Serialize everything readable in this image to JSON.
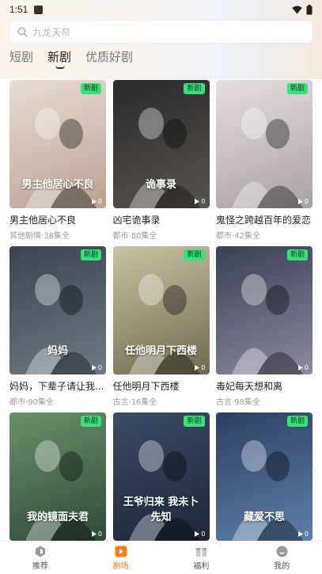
{
  "status_bar": {
    "time": "1:51"
  },
  "search": {
    "placeholder": "九龙天帝"
  },
  "tabs": [
    {
      "label": "短剧",
      "active": false
    },
    {
      "label": "新剧",
      "active": true
    },
    {
      "label": "优质好剧",
      "active": false
    }
  ],
  "badge_label": "新剧",
  "dramas": [
    {
      "title": "男主他居心不良",
      "category": "其他剧情",
      "episodes": "38集全",
      "plays": "0",
      "calligraphy": "男主他居心不良",
      "colors": [
        "#e8dcd4",
        "#b9a294"
      ]
    },
    {
      "title": "凶宅诡事录",
      "category": "都市",
      "episodes": "80集全",
      "plays": "0",
      "calligraphy": "诡事录",
      "colors": [
        "#2b2a2a",
        "#57534e"
      ]
    },
    {
      "title": "鬼怪之跨越百年的爱恋",
      "category": "都市",
      "episodes": "42集全",
      "plays": "0",
      "calligraphy": "",
      "colors": [
        "#e6dede",
        "#a8a0a6"
      ]
    },
    {
      "title": "妈妈，下辈子请让我...",
      "category": "都市",
      "episodes": "90集全",
      "plays": "0",
      "calligraphy": "妈妈",
      "colors": [
        "#3b4350",
        "#6f7a84"
      ]
    },
    {
      "title": "任他明月下西楼",
      "category": "古言",
      "episodes": "16集全",
      "plays": "0",
      "calligraphy": "任他明月下西楼",
      "colors": [
        "#c9c3a4",
        "#6f6a4e"
      ]
    },
    {
      "title": "毒妃每天想和离",
      "category": "古言",
      "episodes": "98集全",
      "plays": "0",
      "calligraphy": "",
      "colors": [
        "#3a3f52",
        "#8c8aa0"
      ]
    },
    {
      "title": "",
      "category": "",
      "episodes": "",
      "plays": "0",
      "calligraphy": "我的镜面夫君",
      "colors": [
        "#6c8f6a",
        "#2f4a39"
      ]
    },
    {
      "title": "",
      "category": "",
      "episodes": "",
      "plays": "0",
      "calligraphy": "王爷归来 我未卜先知",
      "colors": [
        "#3b4a66",
        "#1e2738"
      ]
    },
    {
      "title": "",
      "category": "",
      "episodes": "",
      "plays": "0",
      "calligraphy": "藏爱不思",
      "colors": [
        "#2c3e64",
        "#5f7fa8"
      ]
    }
  ],
  "bottom_nav": [
    {
      "label": "推荐",
      "icon": "hexagon-icon",
      "active": false
    },
    {
      "label": "剧场",
      "icon": "play-box-icon",
      "active": true
    },
    {
      "label": "福利",
      "icon": "gift-icon",
      "active": false
    },
    {
      "label": "我的",
      "icon": "smile-icon",
      "active": false
    }
  ],
  "colors": {
    "accent": "#ff7a1a",
    "badge": "#3ce07a"
  }
}
